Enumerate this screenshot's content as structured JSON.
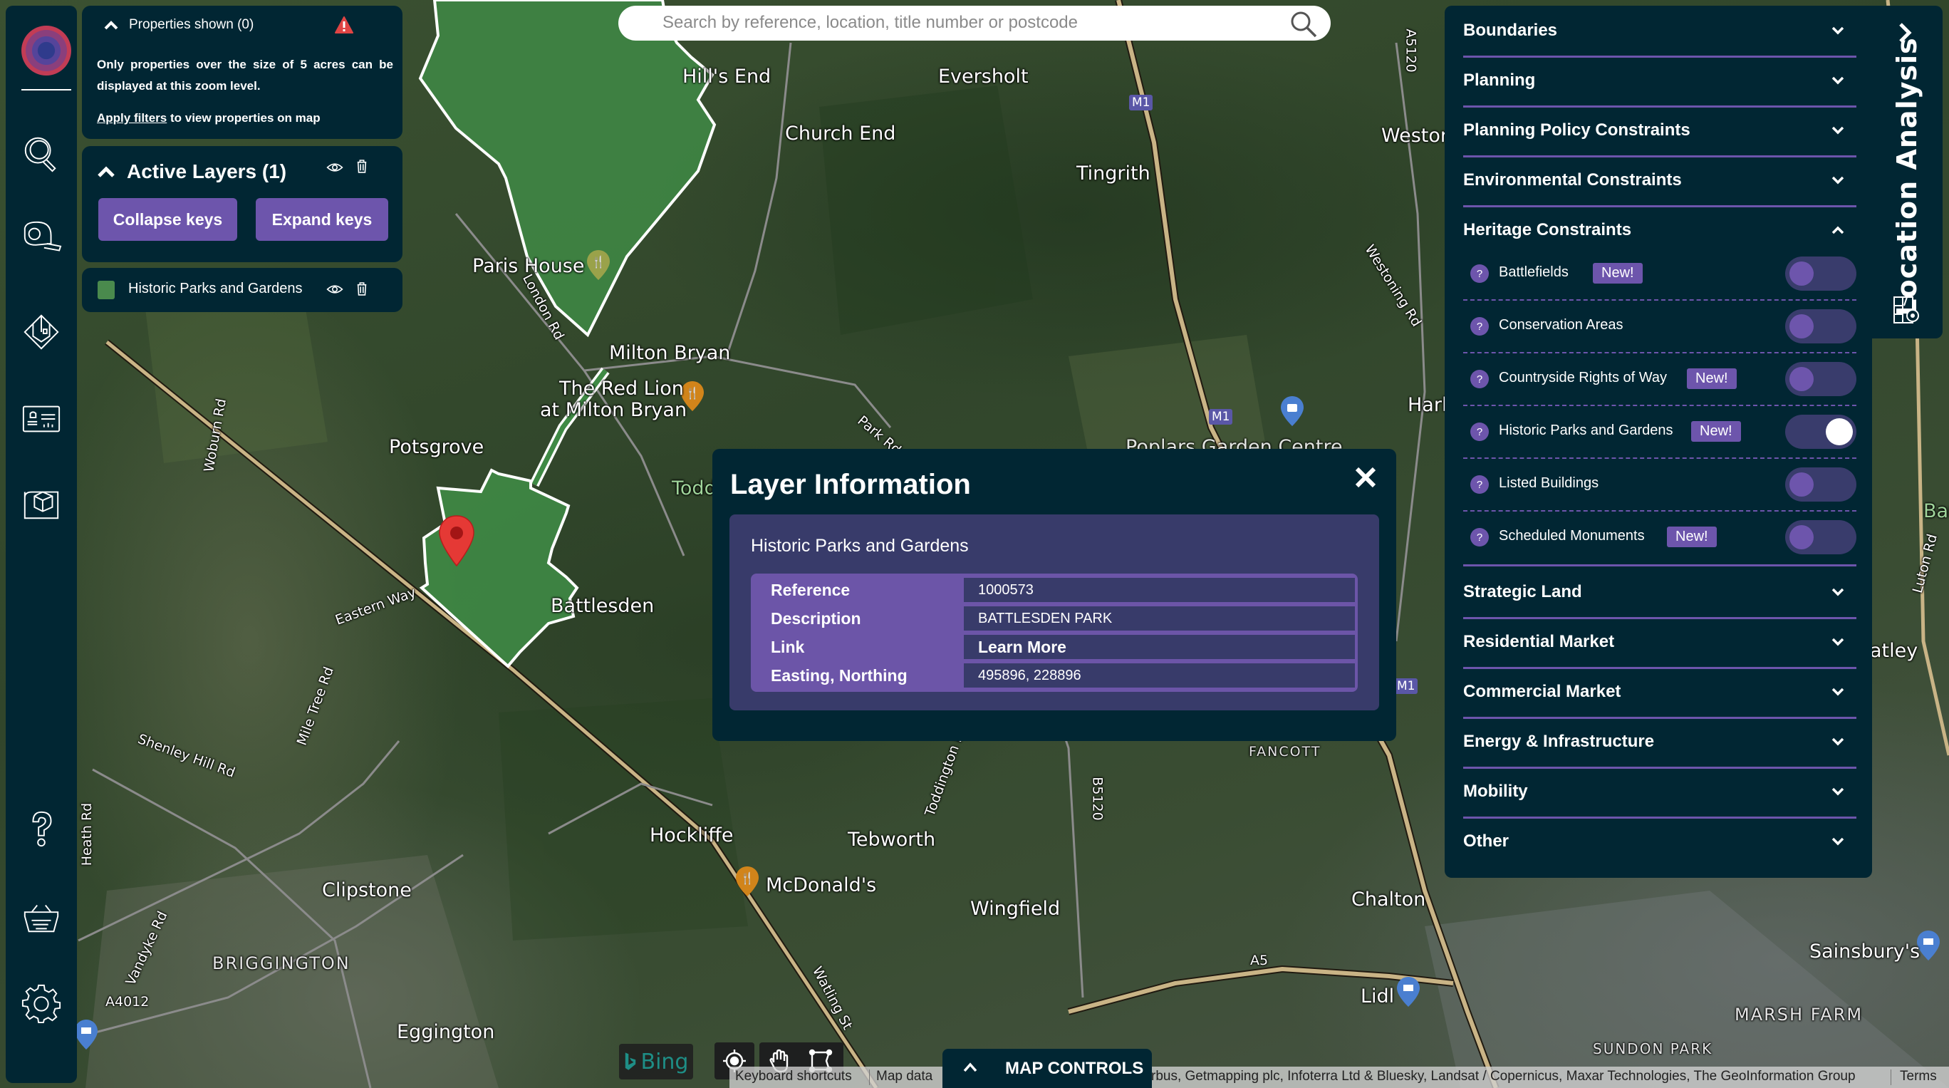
{
  "search": {
    "placeholder": "Search by reference, location, title number or postcode"
  },
  "sidebar": {
    "items": [
      {
        "name": "logo",
        "icon": "target-logo"
      },
      {
        "name": "search",
        "icon": "magnifier-icon"
      },
      {
        "name": "measure",
        "icon": "tape-measure-icon"
      },
      {
        "name": "property",
        "icon": "house-plan-icon"
      },
      {
        "name": "alerts-dashboard",
        "icon": "dashboard-bell-icon"
      },
      {
        "name": "3d-plan",
        "icon": "blueprint-cube-icon"
      },
      {
        "name": "help",
        "icon": "question-icon"
      },
      {
        "name": "basket",
        "icon": "basket-icon"
      },
      {
        "name": "settings",
        "icon": "gear-icon"
      }
    ]
  },
  "properties_panel": {
    "title": "Properties shown (0)",
    "message": "Only properties over the size of 5 acres can be displayed at this zoom level.",
    "apply_link": "Apply filters",
    "apply_suffix": " to view properties on map"
  },
  "active_layers": {
    "title": "Active Layers (1)",
    "collapse_label": "Collapse keys",
    "expand_label": "Expand keys",
    "layers": [
      {
        "name": "Historic Parks and Gardens",
        "color": "#4a8a4d"
      }
    ]
  },
  "popup": {
    "title": "Layer Information",
    "subtitle": "Historic Parks and Gardens",
    "rows": [
      {
        "key": "Reference",
        "value": "1000573"
      },
      {
        "key": "Description",
        "value": "BATTLESDEN PARK"
      },
      {
        "key": "Link",
        "value": "Learn More"
      },
      {
        "key": "Easting, Northing",
        "value": "495896, 228896"
      }
    ]
  },
  "right_panel": {
    "tab_label": "Location Analysis",
    "sections": [
      {
        "label": "Boundaries",
        "expanded": false
      },
      {
        "label": "Planning",
        "expanded": false
      },
      {
        "label": "Planning Policy Constraints",
        "expanded": false
      },
      {
        "label": "Environmental Constraints",
        "expanded": false
      },
      {
        "label": "Heritage Constraints",
        "expanded": true
      },
      {
        "label": "Strategic Land",
        "expanded": false
      },
      {
        "label": "Residential Market",
        "expanded": false
      },
      {
        "label": "Commercial Market",
        "expanded": false
      },
      {
        "label": "Energy & Infrastructure",
        "expanded": false
      },
      {
        "label": "Mobility",
        "expanded": false
      },
      {
        "label": "Other",
        "expanded": false
      }
    ],
    "heritage_items": [
      {
        "label": "Battlefields",
        "new": true,
        "on": false
      },
      {
        "label": "Conservation Areas",
        "new": false,
        "on": false
      },
      {
        "label": "Countryside Rights of Way",
        "new": true,
        "on": false
      },
      {
        "label": "Historic Parks and Gardens",
        "new": true,
        "on": true
      },
      {
        "label": "Listed Buildings",
        "new": false,
        "on": false
      },
      {
        "label": "Scheduled Monuments",
        "new": true,
        "on": false
      }
    ],
    "new_badge": "New!",
    "help_glyph": "?"
  },
  "bottom": {
    "bing": "Bing",
    "map_controls": "MAP CONTROLS",
    "attribution": {
      "keyboard": "Keyboard shortcuts",
      "mapdata": "Map data",
      "credits": "rbus, Getmapping plc, Infoterra Ltd & Bluesky, Landsat / Copernicus, Maxar Technologies, The GeoInformation Group",
      "terms": "Terms"
    }
  },
  "map_labels": [
    {
      "text": "Hill's End",
      "cls": ""
    },
    {
      "text": "Eversholt",
      "cls": ""
    },
    {
      "text": "Church End",
      "cls": ""
    },
    {
      "text": "Tingrith",
      "cls": ""
    },
    {
      "text": "Westor",
      "cls": ""
    },
    {
      "text": "Paris House",
      "cls": ""
    },
    {
      "text": "Milton Bryan",
      "cls": ""
    },
    {
      "text": "The Red Lion",
      "cls": ""
    },
    {
      "text": "at Milton Bryan",
      "cls": ""
    },
    {
      "text": "Potsgrove",
      "cls": ""
    },
    {
      "text": "Todd",
      "cls": "green"
    },
    {
      "text": "Battlesden",
      "cls": ""
    },
    {
      "text": "Harl",
      "cls": ""
    },
    {
      "text": "Hockliffe",
      "cls": ""
    },
    {
      "text": "Tebworth",
      "cls": ""
    },
    {
      "text": "McDonald's",
      "cls": ""
    },
    {
      "text": "Wingfield",
      "cls": ""
    },
    {
      "text": "Chalton",
      "cls": ""
    },
    {
      "text": "Clipstone",
      "cls": ""
    },
    {
      "text": "BRIGGINGTON",
      "cls": "caps"
    },
    {
      "text": "Eggington",
      "cls": ""
    },
    {
      "text": "Lidl",
      "cls": ""
    },
    {
      "text": "Sainsbury's",
      "cls": ""
    },
    {
      "text": "MARSH FARM",
      "cls": "caps"
    },
    {
      "text": "SUNDON PARK",
      "cls": "caps"
    },
    {
      "text": "FANCOTT",
      "cls": "caps"
    },
    {
      "text": "atley",
      "cls": ""
    },
    {
      "text": "Bar",
      "cls": "green"
    },
    {
      "text": "Shenley Hill Rd",
      "cls": "small"
    },
    {
      "text": "Eastern Way",
      "cls": "small"
    },
    {
      "text": "London Rd",
      "cls": "small"
    },
    {
      "text": "Woburn Rd",
      "cls": "small"
    },
    {
      "text": "Mile Tree Rd",
      "cls": "small"
    },
    {
      "text": "Heath Rd",
      "cls": "small"
    },
    {
      "text": "Vandyke Rd",
      "cls": "small"
    },
    {
      "text": "A4012",
      "cls": "small"
    },
    {
      "text": "Watling St",
      "cls": "small"
    },
    {
      "text": "Toddington Rd",
      "cls": "small"
    },
    {
      "text": "B5120",
      "cls": "small"
    },
    {
      "text": "A5120",
      "cls": "small"
    },
    {
      "text": "Westoning Rd",
      "cls": "small"
    },
    {
      "text": "Luton Rd",
      "cls": "small"
    },
    {
      "text": "Park Rd",
      "cls": "small"
    },
    {
      "text": "A5",
      "cls": "small"
    },
    {
      "text": "Poplars Garden Centre",
      "cls": ""
    }
  ],
  "road_shields": [
    "M1",
    "M1",
    "M1"
  ]
}
